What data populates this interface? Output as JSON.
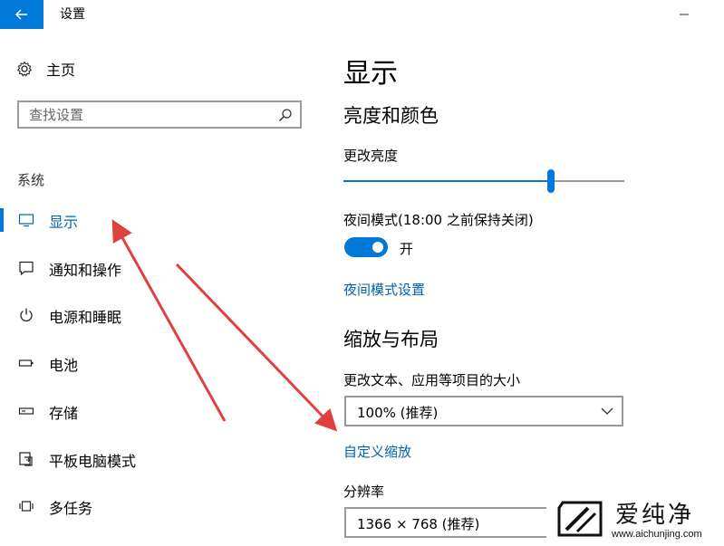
{
  "window": {
    "title": "设置"
  },
  "sidebar": {
    "home_label": "主页",
    "search_placeholder": "查找设置",
    "group_label": "系统",
    "items": [
      {
        "label": "显示",
        "icon": "monitor-icon",
        "selected": true
      },
      {
        "label": "通知和操作",
        "icon": "notification-icon",
        "selected": false
      },
      {
        "label": "电源和睡眠",
        "icon": "power-icon",
        "selected": false
      },
      {
        "label": "电池",
        "icon": "battery-icon",
        "selected": false
      },
      {
        "label": "存储",
        "icon": "storage-icon",
        "selected": false
      },
      {
        "label": "平板电脑模式",
        "icon": "tablet-mode-icon",
        "selected": false
      },
      {
        "label": "多任务",
        "icon": "multitasking-icon",
        "selected": false
      }
    ]
  },
  "main": {
    "page_title": "显示",
    "brightness_section": {
      "title": "亮度和颜色",
      "brightness_label": "更改亮度",
      "brightness_value": 0.74,
      "night_mode_label": "夜间模式(18:00 之前保持关闭)",
      "night_mode_state": "开",
      "night_mode_on": true,
      "night_mode_link": "夜间模式设置"
    },
    "scale_section": {
      "title": "缩放与布局",
      "scale_label": "更改文本、应用等项目的大小",
      "scale_value": "100% (推荐)",
      "custom_scale_link": "自定义缩放",
      "resolution_label": "分辨率",
      "resolution_value": "1366 × 768 (推荐)"
    }
  },
  "watermark": {
    "brand": "爱纯净",
    "url": "www.aichunjing.com"
  },
  "colors": {
    "accent": "#0078d7",
    "link": "#0063b1",
    "annotation_arrow": "#e04040"
  }
}
